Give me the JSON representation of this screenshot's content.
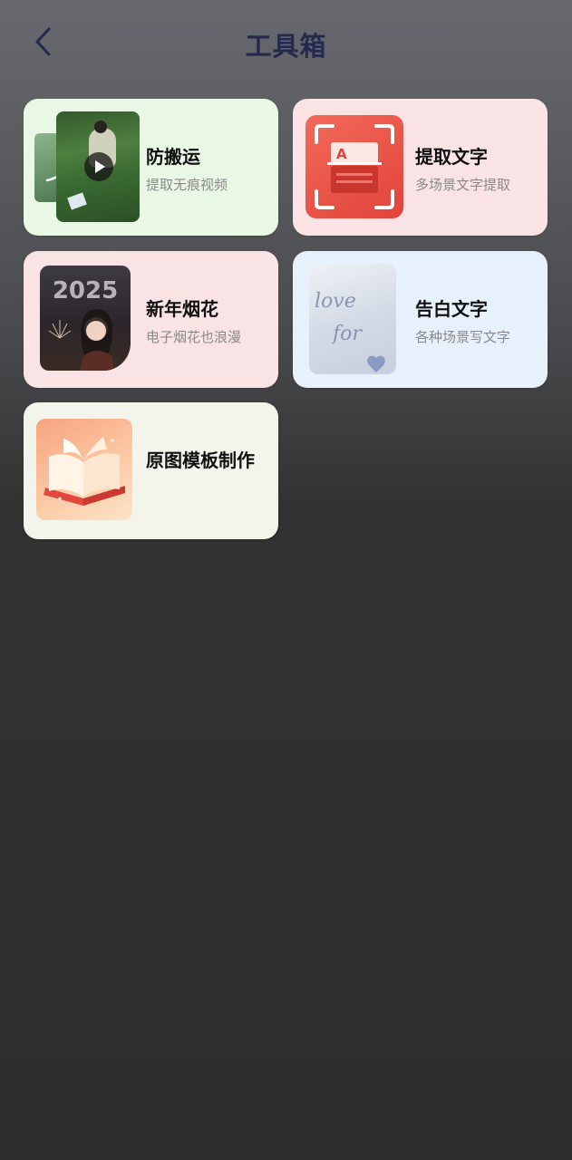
{
  "header": {
    "title": "工具箱",
    "back_icon": "chevron-left-icon"
  },
  "tools": [
    {
      "title": "防搬运",
      "subtitle": "提取无痕视频",
      "bg": "#e8f8e4",
      "icon": "video-play-thumbnail"
    },
    {
      "title": "提取文字",
      "subtitle": "多场景文字提取",
      "bg": "#fae3e5",
      "icon": "text-scan-icon"
    },
    {
      "title": "新年烟花",
      "subtitle": "电子烟花也浪漫",
      "bg": "#fae3e5",
      "icon": "fireworks-thumbnail"
    },
    {
      "title": "告白文字",
      "subtitle": "各种场景写文字",
      "bg": "#e6f1fb",
      "icon": "sand-writing-thumbnail"
    },
    {
      "title": "原图模板制作",
      "subtitle": "",
      "bg": "#f3f5ec",
      "icon": "open-book-icon"
    }
  ],
  "thumb_texts": {
    "scan_letter": "A",
    "fireworks_year": "2025",
    "sand_line1": "love",
    "sand_line2": "for"
  },
  "colors": {
    "title": "#26294f",
    "scan_red": "#ec4f42",
    "text_dark": "#111111",
    "text_muted": "#8a8a8a"
  }
}
